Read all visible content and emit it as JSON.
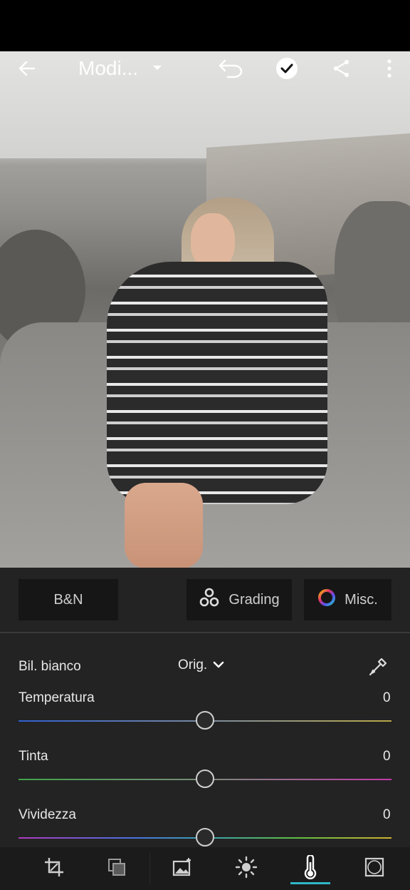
{
  "header": {
    "title": "Modi...",
    "icons": [
      "back-arrow-icon",
      "chevron-down-icon",
      "undo-icon",
      "checkmark-icon",
      "share-icon",
      "more-vertical-icon"
    ]
  },
  "tabs": {
    "bw_label": "B&N",
    "grading_label": "Grading",
    "misc_label": "Misc."
  },
  "white_balance": {
    "label": "Bil. bianco",
    "value": "Orig."
  },
  "sliders": {
    "temperature": {
      "label": "Temperatura",
      "value": "0"
    },
    "tint": {
      "label": "Tinta",
      "value": "0"
    },
    "vibrance": {
      "label": "Vividezza",
      "value": "0"
    }
  },
  "toolbar": {
    "tools": [
      "crop-icon",
      "presets-icon",
      "image-enhance-icon",
      "light-icon",
      "color-temperature-icon",
      "vignette-icon"
    ],
    "active_tool": "color-temperature-icon",
    "accent_color": "#2fb6c8"
  }
}
